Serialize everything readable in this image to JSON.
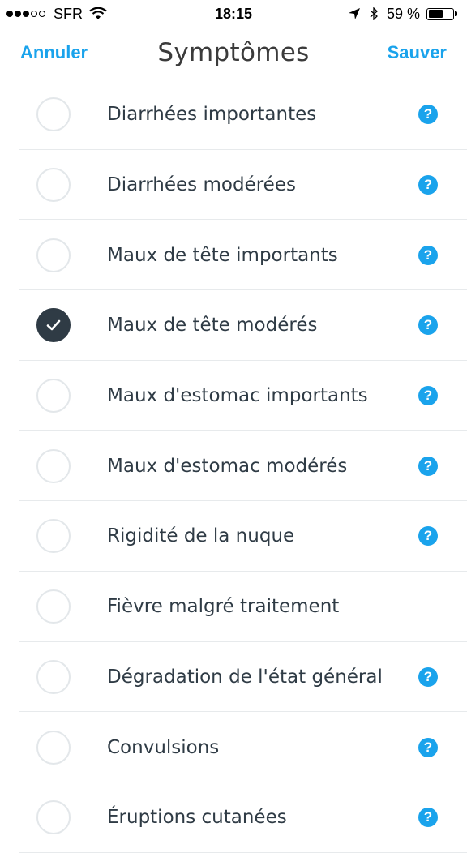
{
  "status_bar": {
    "carrier": "SFR",
    "time": "18:15",
    "battery_text": "59 %",
    "battery_level": 0.59,
    "signal_bars_filled": 3,
    "signal_bars_total": 5
  },
  "nav": {
    "cancel_label": "Annuler",
    "title": "Symptômes",
    "save_label": "Sauver"
  },
  "colors": {
    "accent": "#1aa3ec",
    "checked": "#2f3b45",
    "text": "#2f3b45"
  },
  "help_glyph": "?",
  "symptoms": [
    {
      "label": "Diarrhées importantes",
      "checked": false,
      "has_help": true
    },
    {
      "label": "Diarrhées modérées",
      "checked": false,
      "has_help": true
    },
    {
      "label": "Maux de tête importants",
      "checked": false,
      "has_help": true
    },
    {
      "label": "Maux de tête modérés",
      "checked": true,
      "has_help": true
    },
    {
      "label": "Maux d'estomac importants",
      "checked": false,
      "has_help": true
    },
    {
      "label": "Maux d'estomac modérés",
      "checked": false,
      "has_help": true
    },
    {
      "label": "Rigidité de la nuque",
      "checked": false,
      "has_help": true
    },
    {
      "label": "Fièvre malgré traitement",
      "checked": false,
      "has_help": false
    },
    {
      "label": "Dégradation de l'état général",
      "checked": false,
      "has_help": true
    },
    {
      "label": "Convulsions",
      "checked": false,
      "has_help": true
    },
    {
      "label": "Éruptions cutanées",
      "checked": false,
      "has_help": true
    }
  ]
}
